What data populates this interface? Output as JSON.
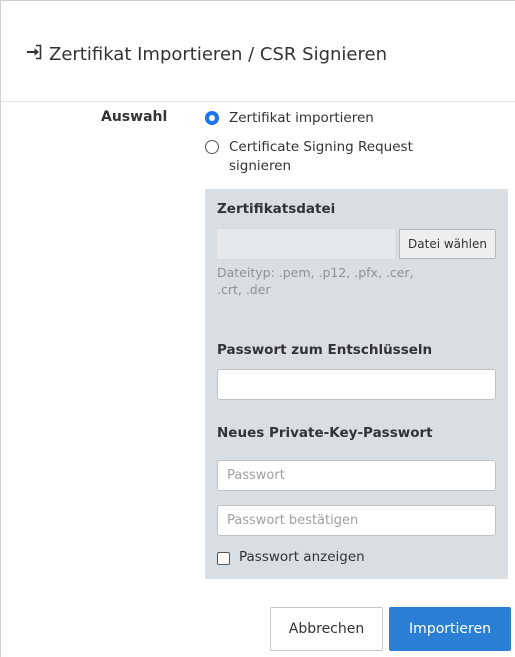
{
  "dialog": {
    "title": "Zertifikat Importieren / CSR Signieren",
    "title_icon": "sign-in-icon"
  },
  "selection": {
    "label": "Auswahl",
    "options": [
      {
        "label": "Zertifikat importieren",
        "checked": true
      },
      {
        "label": "Certificate Signing Request signieren",
        "checked": false
      }
    ]
  },
  "panel": {
    "certificate_file_label": "Zertifikatsdatei",
    "choose_file_button": "Datei wählen",
    "file_type_hint": "Dateityp: .pem, .p12, .pfx, .cer, .crt, .der",
    "decrypt_password_label": "Passwort zum Entschlüsseln",
    "decrypt_password_value": "",
    "new_key_password_label": "Neues Private-Key-Passwort",
    "password_placeholder": "Passwort",
    "confirm_placeholder": "Passwort bestätigen",
    "show_password_label": "Passwort anzeigen",
    "show_password_checked": false
  },
  "buttons": {
    "cancel": "Abbrechen",
    "import": "Importieren"
  },
  "colors": {
    "primary": "#2a7fd4",
    "radio_selected": "#1a73e8",
    "panel_background": "#d9dee2"
  }
}
